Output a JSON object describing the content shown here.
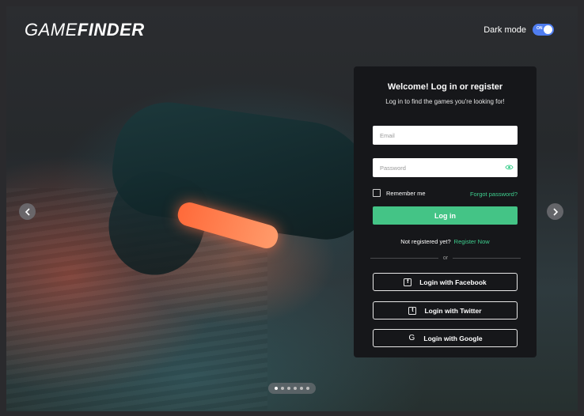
{
  "brand": {
    "logo_light": "GAME",
    "logo_bold": "FINDER"
  },
  "header": {
    "dark_mode_label": "Dark mode",
    "toggle_state": "ON",
    "dark_mode_on": true
  },
  "carousel": {
    "prev_icon": "chevron-left-icon",
    "next_icon": "chevron-right-icon",
    "slide_count": 6,
    "active_slide": 1
  },
  "login": {
    "title": "Welcome! Log in or register",
    "subtitle": "Log in to find the games you're looking for!",
    "email_placeholder": "Email",
    "password_placeholder": "Password",
    "remember_label": "Remember me",
    "forgot_label": "Forgot password?",
    "login_button": "Log in",
    "not_registered": "Not registered yet?",
    "register_link": "Register Now",
    "divider": "or",
    "facebook_label": "Login with Facebook",
    "twitter_label": "Login with Twitter",
    "google_label": "Login with Google"
  },
  "colors": {
    "accent_green": "#44c486",
    "toggle_blue": "#4f7df0",
    "panel_bg": "#16171a"
  }
}
